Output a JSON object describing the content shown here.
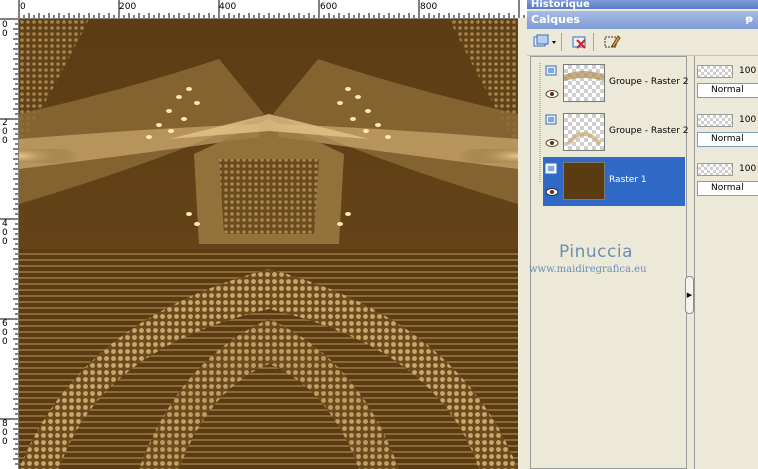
{
  "ruler": {
    "top_labels": [
      "0",
      "200",
      "400",
      "600",
      "800"
    ],
    "left_labels": [
      [
        "0",
        "0"
      ],
      [
        "2",
        "0",
        "0"
      ],
      [
        "4",
        "0",
        "0"
      ],
      [
        "6",
        "0",
        "0"
      ],
      [
        "8",
        "0",
        "0"
      ]
    ]
  },
  "panels": {
    "history_title": "Historique",
    "layers_title": "Calques",
    "pin_glyph": "ᵽ"
  },
  "layers": [
    {
      "name": "Groupe - Raster 2",
      "opacity": "100",
      "blend": "Normal",
      "selected": false
    },
    {
      "name": "Groupe - Raster 2",
      "opacity": "100",
      "blend": "Normal",
      "selected": false
    },
    {
      "name": "Raster 1",
      "opacity": "100",
      "blend": "Normal",
      "selected": true
    }
  ],
  "watermark": {
    "title": "Pinuccia",
    "url": "www.maidiregrafica.eu"
  },
  "colors": {
    "canvas_base": "#5a3b12",
    "selection": "#3169c6",
    "title_bar": "#7f9ad4",
    "watermark": "#6e8fb5"
  },
  "icons": [
    "new-layer-icon",
    "delete-layer-icon",
    "edit-selection-icon",
    "eye-icon",
    "layer-type-icon"
  ]
}
